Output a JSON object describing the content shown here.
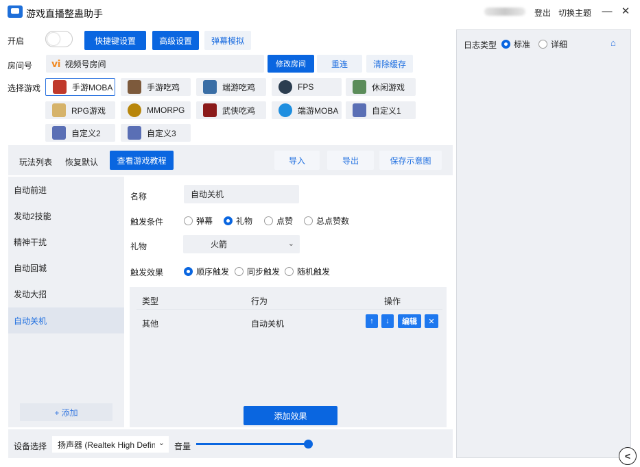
{
  "window": {
    "title": "游戏直播整蛊助手",
    "logout": "登出",
    "switch_theme": "切换主题",
    "minimize": "—",
    "close": "✕"
  },
  "top": {
    "enable_label": "开启",
    "enabled": false,
    "hotkey_btn": "快捷键设置",
    "advanced_btn": "高级设置",
    "danmaku_btn": "弹幕模拟",
    "room_label": "房间号",
    "room_value": "视频号房间",
    "modify_room_btn": "修改房间",
    "reconnect_btn": "重连",
    "clear_cache_btn": "清除缓存",
    "select_game_label": "选择游戏"
  },
  "games": [
    {
      "label": "手游MOBA",
      "selected": true,
      "color": "#c0392b"
    },
    {
      "label": "手游吃鸡",
      "selected": false,
      "color": "#7d5a3c"
    },
    {
      "label": "端游吃鸡",
      "selected": false,
      "color": "#3a6ea5"
    },
    {
      "label": "FPS",
      "selected": false,
      "color": "#2c3e50"
    },
    {
      "label": "休闲游戏",
      "selected": false,
      "color": "#5b8c5a"
    },
    {
      "label": "RPG游戏",
      "selected": false,
      "color": "#d6b36a"
    },
    {
      "label": "MMORPG",
      "selected": false,
      "color": "#b8860b"
    },
    {
      "label": "武侠吃鸡",
      "selected": false,
      "color": "#8b1a1a"
    },
    {
      "label": "端游MOBA",
      "selected": false,
      "color": "#1f8fe0"
    },
    {
      "label": "自定义1",
      "selected": false,
      "color": "#5a6fb5"
    },
    {
      "label": "自定义2",
      "selected": false,
      "color": "#5a6fb5"
    },
    {
      "label": "自定义3",
      "selected": false,
      "color": "#5a6fb5"
    }
  ],
  "toolbar": {
    "play_list": "玩法列表",
    "restore_default": "恢复默认",
    "view_tutorial": "查看游戏教程",
    "import": "导入",
    "export": "导出",
    "save_diagram": "保存示意图"
  },
  "play_items": [
    {
      "label": "自动前进",
      "active": false
    },
    {
      "label": "发动2技能",
      "active": false
    },
    {
      "label": "精神干扰",
      "active": false
    },
    {
      "label": "自动回城",
      "active": false
    },
    {
      "label": "发动大招",
      "active": false
    },
    {
      "label": "自动关机",
      "active": true
    }
  ],
  "add_btn": "+ 添加",
  "detail": {
    "name_label": "名称",
    "name_value": "自动关机",
    "trigger_label": "触发条件",
    "trigger_options": [
      {
        "label": "弹幕",
        "on": false
      },
      {
        "label": "礼物",
        "on": true
      },
      {
        "label": "点赞",
        "on": false
      },
      {
        "label": "总点赞数",
        "on": false
      }
    ],
    "gift_label": "礼物",
    "gift_value": "火箭",
    "effect_label": "触发效果",
    "effect_options": [
      {
        "label": "顺序触发",
        "on": true
      },
      {
        "label": "同步触发",
        "on": false
      },
      {
        "label": "随机触发",
        "on": false
      }
    ]
  },
  "effects_table": {
    "headers": [
      "类型",
      "行为",
      "操作"
    ],
    "rows": [
      {
        "type": "其他",
        "action": "自动关机"
      }
    ],
    "op_up": "↑",
    "op_down": "↓",
    "op_edit": "编辑",
    "op_delete": "✕",
    "add_effect_btn": "添加效果"
  },
  "bottom": {
    "device_label": "设备选择",
    "device_value": "扬声器 (Realtek High Definit",
    "volume_label": "音量",
    "volume_level": 1.0
  },
  "log": {
    "type_label": "日志类型",
    "options": [
      {
        "label": "标准",
        "on": true
      },
      {
        "label": "详细",
        "on": false
      }
    ]
  },
  "colors": {
    "accent": "#0a66e0",
    "panel_bg": "#eef0f4"
  }
}
